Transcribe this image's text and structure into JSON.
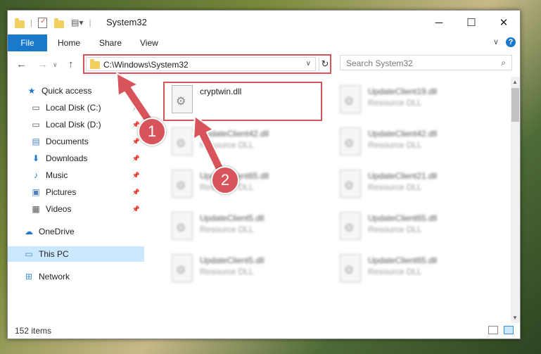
{
  "window": {
    "title": "System32"
  },
  "ribbon": {
    "tabs": [
      "File",
      "Home",
      "Share",
      "View"
    ],
    "help": "?"
  },
  "nav": {
    "back": "←",
    "forward": "→",
    "up": "↑",
    "address": "C:\\Windows\\System32",
    "refresh": "↻",
    "search_placeholder": "Search System32"
  },
  "sidebar": {
    "items": [
      {
        "label": "Quick access",
        "icon": "star-icon"
      },
      {
        "label": "Local Disk (C:)",
        "icon": "drive-icon"
      },
      {
        "label": "Local Disk (D:)",
        "icon": "drive-icon"
      },
      {
        "label": "Documents",
        "icon": "documents-icon"
      },
      {
        "label": "Downloads",
        "icon": "download-icon"
      },
      {
        "label": "Music",
        "icon": "music-icon"
      },
      {
        "label": "Pictures",
        "icon": "pictures-icon"
      },
      {
        "label": "Videos",
        "icon": "videos-icon"
      },
      {
        "label": "OneDrive",
        "icon": "cloud-icon"
      },
      {
        "label": "This PC",
        "icon": "computer-icon"
      },
      {
        "label": "Network",
        "icon": "network-icon"
      }
    ]
  },
  "files": [
    {
      "name": "cryptwin.dll",
      "type": ""
    },
    {
      "name": "UpdateClient19.dll",
      "type": "Resource DLL"
    },
    {
      "name": "UpdateClient42.dll",
      "type": "Resource DLL"
    },
    {
      "name": "UpdateClient42.dll",
      "type": "Resource DLL"
    },
    {
      "name": "UpdateClient65.dll",
      "type": "Resource DLL"
    },
    {
      "name": "UpdateClient21.dll",
      "type": "Resource DLL"
    },
    {
      "name": "UpdateClient5.dll",
      "type": "Resource DLL"
    },
    {
      "name": "UpdateClient65.dll",
      "type": "Resource DLL"
    },
    {
      "name": "UpdateClient5.dll",
      "type": "Resource DLL"
    },
    {
      "name": "UpdateClient65.dll",
      "type": "Resource DLL"
    }
  ],
  "status": {
    "items": "152 items"
  },
  "annotations": {
    "step1": "1",
    "step2": "2",
    "color": "#d9535a"
  }
}
